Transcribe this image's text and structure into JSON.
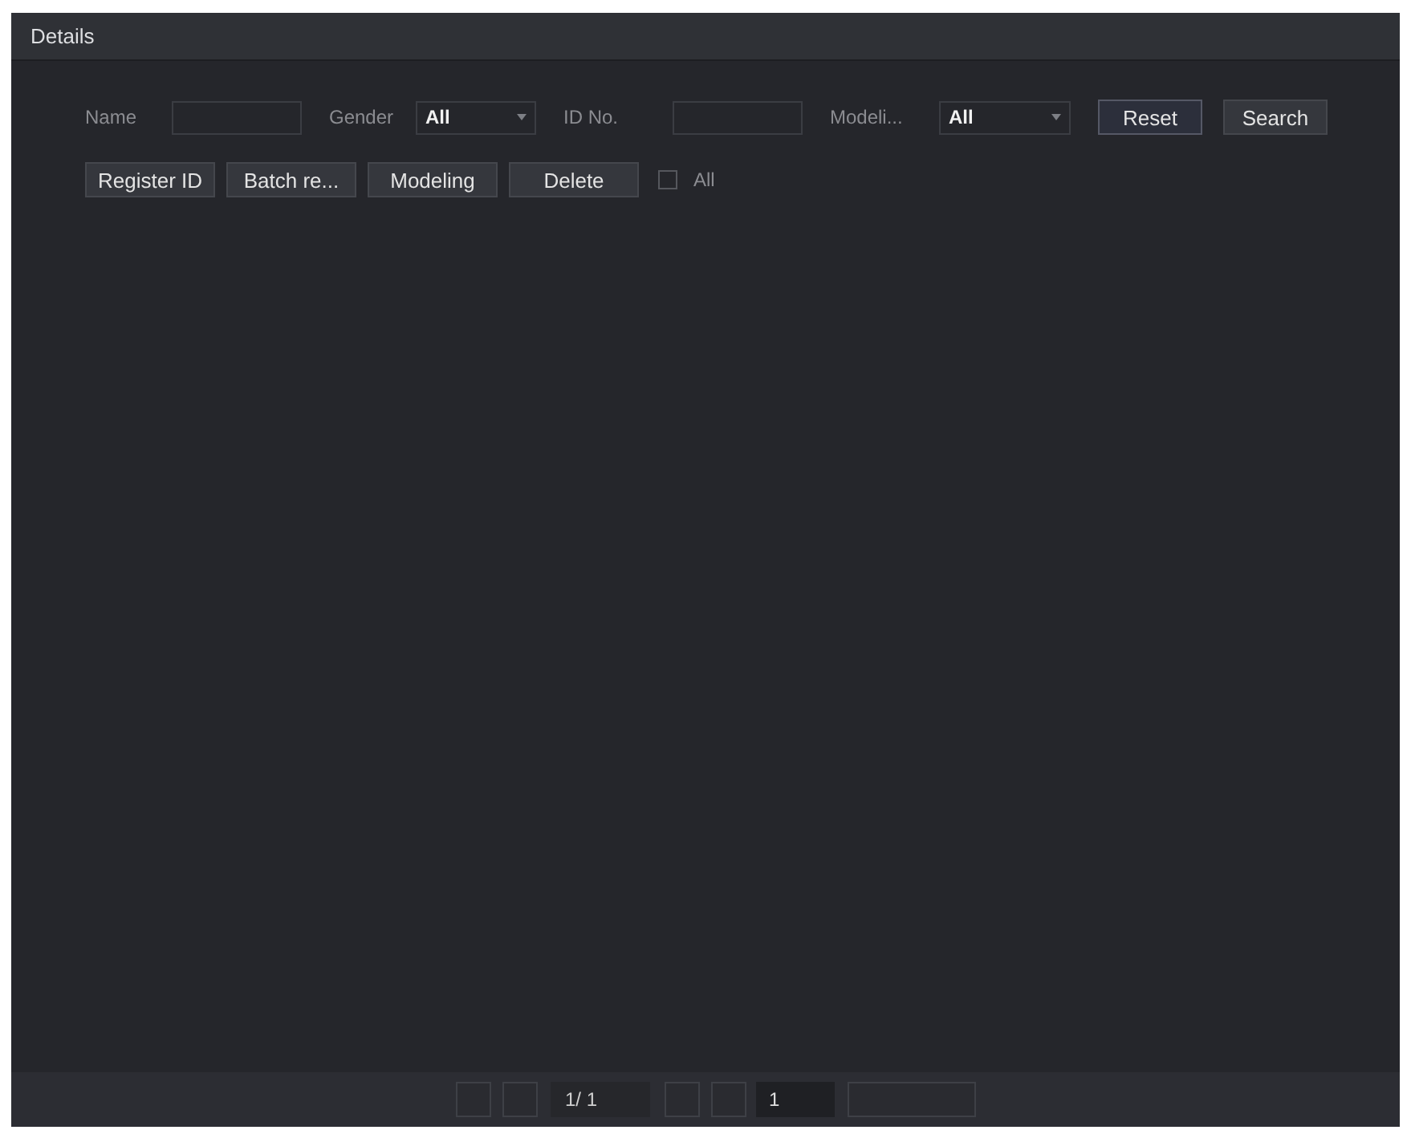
{
  "window": {
    "title": "Details"
  },
  "filters": [
    {
      "kind": "input",
      "label": "Name"
    },
    {
      "kind": "select",
      "label": "Gender",
      "value": "All"
    },
    {
      "kind": "input",
      "label": "ID No."
    },
    {
      "kind": "select",
      "label": "Modeli...",
      "value": "All"
    }
  ],
  "filter_buttons": [
    {
      "label": "Reset",
      "focused": true
    },
    {
      "label": "Search",
      "focused": false
    }
  ],
  "actions": [
    {
      "label": "Register ID"
    },
    {
      "label": "Batch re..."
    },
    {
      "label": "Modeling"
    },
    {
      "label": "Delete"
    }
  ],
  "select_all": {
    "label": "All",
    "checked": false
  },
  "pager": {
    "page": "1/ 1",
    "jump_value": "1"
  }
}
